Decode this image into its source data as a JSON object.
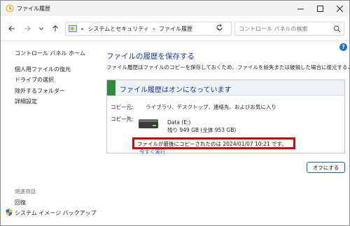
{
  "window": {
    "title": "ファイル履歴"
  },
  "address": {
    "crumbs": [
      "«",
      "システムとセキュリティ",
      "›",
      "ファイル履歴"
    ]
  },
  "search": {
    "placeholder": "コントロール パネルの検索"
  },
  "sidebar": {
    "home": "コントロール パネル ホーム",
    "items": [
      {
        "label": "個人用ファイルの復元"
      },
      {
        "label": "ドライブの選択"
      },
      {
        "label": "除外するフォルダー"
      },
      {
        "label": "詳細設定"
      }
    ],
    "related_heading": "関連項目",
    "related": [
      {
        "label": "回復"
      },
      {
        "label": "システム イメージ バックアップ"
      }
    ]
  },
  "main": {
    "title": "ファイルの履歴を保存する",
    "description": "ファイル履歴はファイルのコピーを保存しておくため、ファイルを紛失または破損した場合に復元することができます",
    "panel": {
      "title": "ファイル履歴はオンになっています",
      "copy_from_label": "コピー元:",
      "copy_from_value": "ライブラリ、デスクトップ、連絡先、およびお気に入り",
      "copy_to_label": "コピー先:",
      "drive_name": "Data  (E:)",
      "drive_space": "残り 949 GB (全体 953 GB)",
      "last_copy": "ファイルが最後にコピーされたのは 2024/01/07 10:21 です。",
      "run_now": "今すぐ実行"
    },
    "off_button": "オフにする"
  },
  "colors": {
    "accent": "#0067c0",
    "heading": "#1e3287",
    "status_green": "#2e8a36",
    "highlight": "#e00000"
  }
}
